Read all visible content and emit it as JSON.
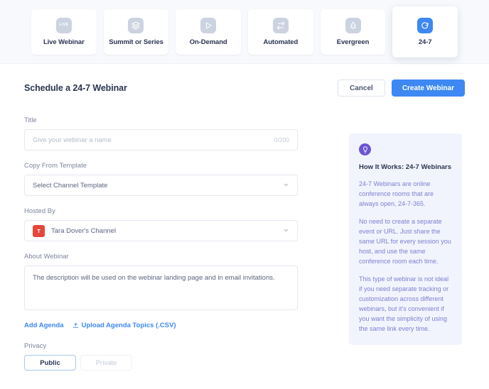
{
  "tabs": [
    {
      "label": "Live Webinar",
      "icon": "live-badge-icon",
      "selected": false
    },
    {
      "label": "Summit or Series",
      "icon": "layers-icon",
      "selected": false
    },
    {
      "label": "On-Demand",
      "icon": "play-icon",
      "selected": false
    },
    {
      "label": "Automated",
      "icon": "swap-arrows-icon",
      "selected": false
    },
    {
      "label": "Evergreen",
      "icon": "tree-icon",
      "selected": false
    },
    {
      "label": "24-7",
      "icon": "refresh-clock-icon",
      "selected": true
    }
  ],
  "header": {
    "title": "Schedule a 24-7 Webinar",
    "cancel_label": "Cancel",
    "create_label": "Create Webinar"
  },
  "form": {
    "title_label": "Title",
    "title_placeholder": "Give your webinar a name",
    "title_value": "",
    "title_counter": "0/200",
    "template_label": "Copy From Template",
    "template_value": "Select Channel Template",
    "hosted_by_label": "Hosted By",
    "hosted_by_value": "Tara Dover's Channel",
    "hosted_by_avatar": "T",
    "about_label": "About Webinar",
    "about_placeholder": "The description will be used on the webinar landing page and in email invitations.",
    "add_agenda_label": "Add Agenda",
    "upload_agenda_label": "Upload Agenda Topics (.CSV)",
    "privacy_label": "Privacy",
    "privacy_public": "Public",
    "privacy_private": "Private",
    "privacy_selected": "Public"
  },
  "info": {
    "icon": "lightbulb-icon",
    "title": "How It Works: 24-7 Webinars",
    "paragraphs": [
      "24-7 Webinars are online conference rooms that are always open, 24-7-365.",
      "No need to create a separate event or URL. Just share the same URL for every session you host, and use the same conference room each time.",
      "This type of webinar is not ideal if you need separate tracking or customization across different webinars, but it's convenient if you want the simplicity of using the same link every time."
    ]
  },
  "colors": {
    "accent_blue": "#3d88f2",
    "icon_gray": "#ccd3e0",
    "avatar_red": "#e4483b",
    "info_purple": "#6c55d4",
    "info_text": "#7c7fd0",
    "info_bg": "#f2f4fd",
    "strip_bg": "#f7f9fc"
  }
}
